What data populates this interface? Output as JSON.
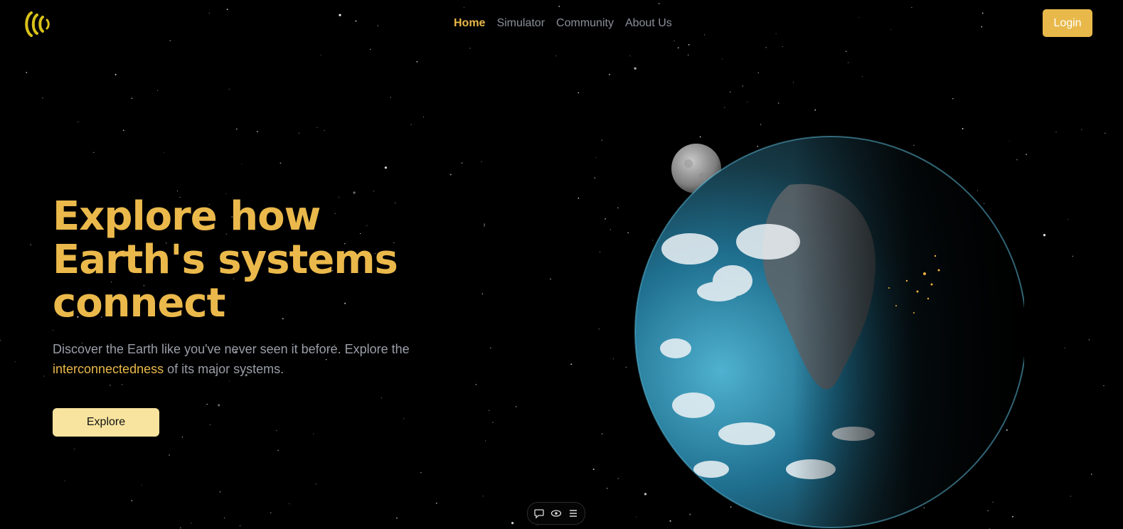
{
  "nav": {
    "items": [
      "Home",
      "Simulator",
      "Community",
      "About Us"
    ],
    "active": "Home"
  },
  "login_label": "Login",
  "hero": {
    "title_lines": [
      "Explore how",
      "Earth's systems",
      "connect"
    ],
    "subtitle_part1": "Discover the Earth like you've never seen it before. Explore the",
    "subtitle_highlight": "interconnectedness",
    "subtitle_part2": "of its major systems.",
    "cta_label": "Explore"
  },
  "icons": {
    "logo": "concentric-arcs-logo-icon",
    "toolbar": [
      "chat-bubble-icon",
      "eye-icon",
      "menu-icon"
    ]
  },
  "colors": {
    "accent": "#e9b84a",
    "cta_background": "#f8e49e",
    "nav_inactive": "#8b8f99",
    "background": "#000000"
  }
}
